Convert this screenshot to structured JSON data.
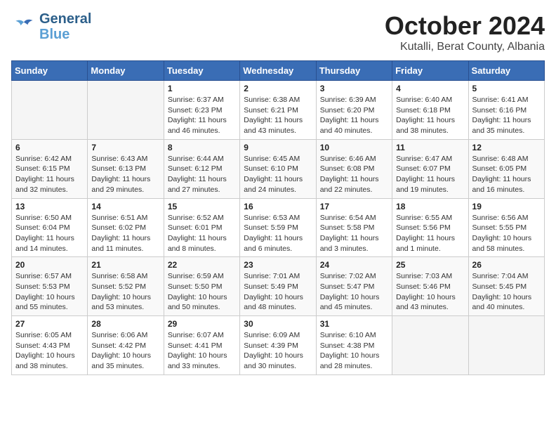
{
  "logo": {
    "line1": "General",
    "line2": "Blue"
  },
  "title": "October 2024",
  "subtitle": "Kutalli, Berat County, Albania",
  "days_of_week": [
    "Sunday",
    "Monday",
    "Tuesday",
    "Wednesday",
    "Thursday",
    "Friday",
    "Saturday"
  ],
  "weeks": [
    [
      {
        "day": "",
        "info": ""
      },
      {
        "day": "",
        "info": ""
      },
      {
        "day": "1",
        "info": "Sunrise: 6:37 AM\nSunset: 6:23 PM\nDaylight: 11 hours and 46 minutes."
      },
      {
        "day": "2",
        "info": "Sunrise: 6:38 AM\nSunset: 6:21 PM\nDaylight: 11 hours and 43 minutes."
      },
      {
        "day": "3",
        "info": "Sunrise: 6:39 AM\nSunset: 6:20 PM\nDaylight: 11 hours and 40 minutes."
      },
      {
        "day": "4",
        "info": "Sunrise: 6:40 AM\nSunset: 6:18 PM\nDaylight: 11 hours and 38 minutes."
      },
      {
        "day": "5",
        "info": "Sunrise: 6:41 AM\nSunset: 6:16 PM\nDaylight: 11 hours and 35 minutes."
      }
    ],
    [
      {
        "day": "6",
        "info": "Sunrise: 6:42 AM\nSunset: 6:15 PM\nDaylight: 11 hours and 32 minutes."
      },
      {
        "day": "7",
        "info": "Sunrise: 6:43 AM\nSunset: 6:13 PM\nDaylight: 11 hours and 29 minutes."
      },
      {
        "day": "8",
        "info": "Sunrise: 6:44 AM\nSunset: 6:12 PM\nDaylight: 11 hours and 27 minutes."
      },
      {
        "day": "9",
        "info": "Sunrise: 6:45 AM\nSunset: 6:10 PM\nDaylight: 11 hours and 24 minutes."
      },
      {
        "day": "10",
        "info": "Sunrise: 6:46 AM\nSunset: 6:08 PM\nDaylight: 11 hours and 22 minutes."
      },
      {
        "day": "11",
        "info": "Sunrise: 6:47 AM\nSunset: 6:07 PM\nDaylight: 11 hours and 19 minutes."
      },
      {
        "day": "12",
        "info": "Sunrise: 6:48 AM\nSunset: 6:05 PM\nDaylight: 11 hours and 16 minutes."
      }
    ],
    [
      {
        "day": "13",
        "info": "Sunrise: 6:50 AM\nSunset: 6:04 PM\nDaylight: 11 hours and 14 minutes."
      },
      {
        "day": "14",
        "info": "Sunrise: 6:51 AM\nSunset: 6:02 PM\nDaylight: 11 hours and 11 minutes."
      },
      {
        "day": "15",
        "info": "Sunrise: 6:52 AM\nSunset: 6:01 PM\nDaylight: 11 hours and 8 minutes."
      },
      {
        "day": "16",
        "info": "Sunrise: 6:53 AM\nSunset: 5:59 PM\nDaylight: 11 hours and 6 minutes."
      },
      {
        "day": "17",
        "info": "Sunrise: 6:54 AM\nSunset: 5:58 PM\nDaylight: 11 hours and 3 minutes."
      },
      {
        "day": "18",
        "info": "Sunrise: 6:55 AM\nSunset: 5:56 PM\nDaylight: 11 hours and 1 minute."
      },
      {
        "day": "19",
        "info": "Sunrise: 6:56 AM\nSunset: 5:55 PM\nDaylight: 10 hours and 58 minutes."
      }
    ],
    [
      {
        "day": "20",
        "info": "Sunrise: 6:57 AM\nSunset: 5:53 PM\nDaylight: 10 hours and 55 minutes."
      },
      {
        "day": "21",
        "info": "Sunrise: 6:58 AM\nSunset: 5:52 PM\nDaylight: 10 hours and 53 minutes."
      },
      {
        "day": "22",
        "info": "Sunrise: 6:59 AM\nSunset: 5:50 PM\nDaylight: 10 hours and 50 minutes."
      },
      {
        "day": "23",
        "info": "Sunrise: 7:01 AM\nSunset: 5:49 PM\nDaylight: 10 hours and 48 minutes."
      },
      {
        "day": "24",
        "info": "Sunrise: 7:02 AM\nSunset: 5:47 PM\nDaylight: 10 hours and 45 minutes."
      },
      {
        "day": "25",
        "info": "Sunrise: 7:03 AM\nSunset: 5:46 PM\nDaylight: 10 hours and 43 minutes."
      },
      {
        "day": "26",
        "info": "Sunrise: 7:04 AM\nSunset: 5:45 PM\nDaylight: 10 hours and 40 minutes."
      }
    ],
    [
      {
        "day": "27",
        "info": "Sunrise: 6:05 AM\nSunset: 4:43 PM\nDaylight: 10 hours and 38 minutes."
      },
      {
        "day": "28",
        "info": "Sunrise: 6:06 AM\nSunset: 4:42 PM\nDaylight: 10 hours and 35 minutes."
      },
      {
        "day": "29",
        "info": "Sunrise: 6:07 AM\nSunset: 4:41 PM\nDaylight: 10 hours and 33 minutes."
      },
      {
        "day": "30",
        "info": "Sunrise: 6:09 AM\nSunset: 4:39 PM\nDaylight: 10 hours and 30 minutes."
      },
      {
        "day": "31",
        "info": "Sunrise: 6:10 AM\nSunset: 4:38 PM\nDaylight: 10 hours and 28 minutes."
      },
      {
        "day": "",
        "info": ""
      },
      {
        "day": "",
        "info": ""
      }
    ]
  ]
}
